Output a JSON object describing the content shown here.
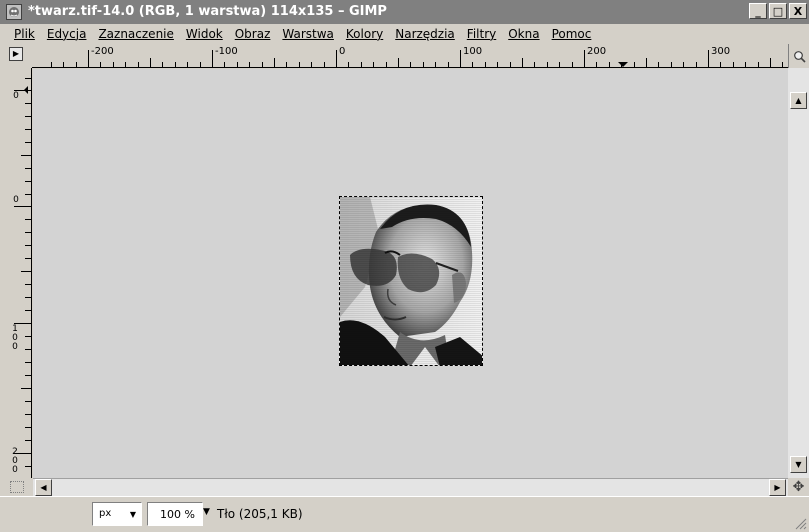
{
  "window": {
    "title": "*twarz.tif-14.0 (RGB, 1 warstwa) 114x135 – GIMP",
    "minimize_label": "_",
    "maximize_label": "□",
    "close_label": "X"
  },
  "menubar": {
    "items": [
      {
        "label": "Plik"
      },
      {
        "label": "Edycja"
      },
      {
        "label": "Zaznaczenie"
      },
      {
        "label": "Widok"
      },
      {
        "label": "Obraz"
      },
      {
        "label": "Warstwa"
      },
      {
        "label": "Kolory"
      },
      {
        "label": "Narzędzia"
      },
      {
        "label": "Filtry"
      },
      {
        "label": "Okna"
      },
      {
        "label": "Pomoc"
      }
    ]
  },
  "hruler": {
    "labels": [
      "-200",
      "-100",
      "0",
      "100",
      "200",
      "300"
    ]
  },
  "vruler": {
    "labels": [
      "0",
      "0",
      "100",
      "200"
    ]
  },
  "statusbar": {
    "unit": "px",
    "zoom": "100 %",
    "status": "Tło (205,1 KB)"
  },
  "icons": {
    "app": "gimp-app-icon",
    "quick_mask": "quick-mask-icon",
    "zoom_fit": "zoom-fit-icon",
    "navigate": "navigate-icon",
    "resize_grip": "resize-grip-icon"
  }
}
